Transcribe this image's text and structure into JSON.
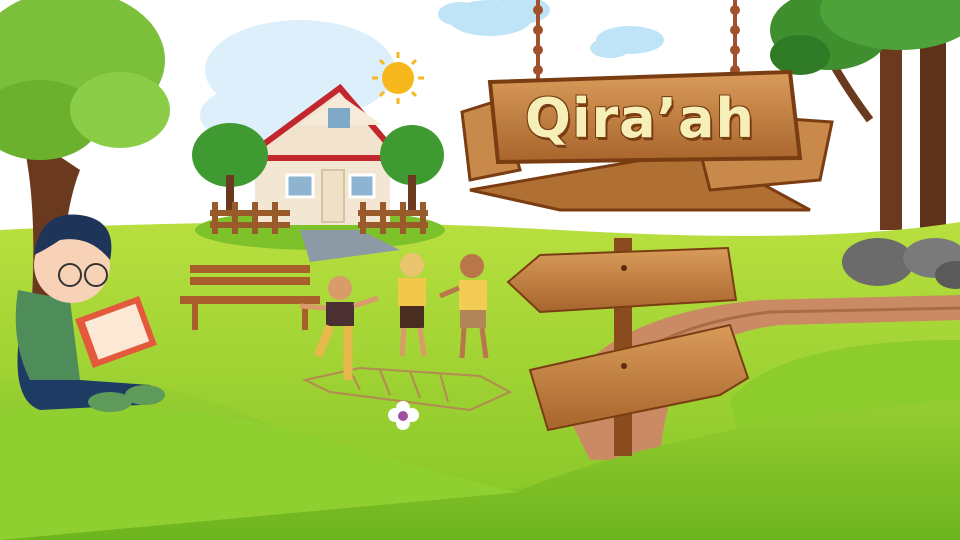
{
  "scene": {
    "title": "Qira’ah"
  },
  "colors": {
    "sky": "#ffffff",
    "grass_light": "#a8d636",
    "grass_dark": "#6fb21d",
    "wood": "#c8894a",
    "wood_dark": "#7a3d12",
    "title_text": "#f6f0b8",
    "path": "#c98a64"
  }
}
